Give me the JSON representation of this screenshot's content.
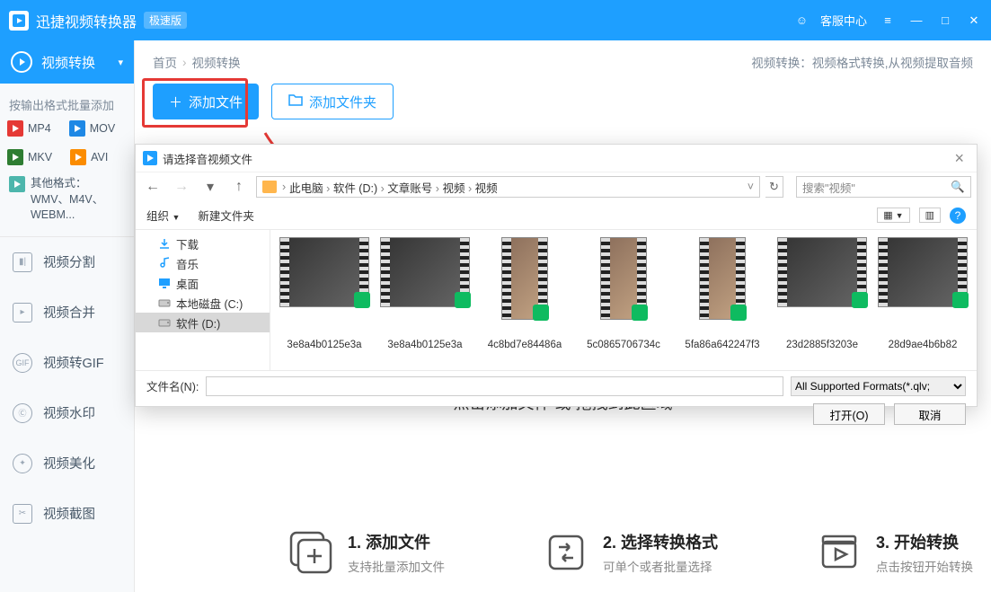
{
  "titlebar": {
    "app_name": "迅捷视频转换器",
    "edition": "极速版",
    "customer_service": "客服中心"
  },
  "sidebar": {
    "active_nav": "视频转换",
    "batch_label": "按输出格式批量添加",
    "formats": [
      {
        "label": "MP4",
        "color": "#E53935"
      },
      {
        "label": "MOV",
        "color": "#1E88E5"
      },
      {
        "label": "MKV",
        "color": "#2E7D32"
      },
      {
        "label": "AVI",
        "color": "#FB8C00"
      }
    ],
    "other_formats": "其他格式：WMV、M4V、WEBM...",
    "nav_items": [
      {
        "label": "视频分割"
      },
      {
        "label": "视频合并"
      },
      {
        "label": "视频转GIF"
      },
      {
        "label": "视频水印"
      },
      {
        "label": "视频美化"
      },
      {
        "label": "视频截图"
      }
    ]
  },
  "breadcrumb": {
    "home": "首页",
    "current": "视频转换",
    "desc": "视频转换：视频格式转换,从视频提取音频"
  },
  "actions": {
    "add_file": "添加文件",
    "add_folder": "添加文件夹"
  },
  "drop_hint": "点击添加文件 或 拖拽到此区域",
  "steps": [
    {
      "title": "1. 添加文件",
      "sub": "支持批量添加文件"
    },
    {
      "title": "2. 选择转换格式",
      "sub": "可单个或者批量选择"
    },
    {
      "title": "3. 开始转换",
      "sub": "点击按钮开始转换"
    }
  ],
  "dialog": {
    "title": "请选择音视频文件",
    "path": [
      "此电脑",
      "软件 (D:)",
      "文章账号",
      "视频",
      "视频"
    ],
    "search_placeholder": "搜索\"视频\"",
    "organize": "组织",
    "new_folder": "新建文件夹",
    "tree": [
      {
        "label": "下载",
        "icon": "download"
      },
      {
        "label": "音乐",
        "icon": "music"
      },
      {
        "label": "桌面",
        "icon": "desktop"
      },
      {
        "label": "本地磁盘 (C:)",
        "icon": "disk"
      },
      {
        "label": "软件 (D:)",
        "icon": "disk",
        "selected": true
      }
    ],
    "files": [
      {
        "name": "3e8a4b0125e3a",
        "shape": "wide",
        "badge": "play"
      },
      {
        "name": "3e8a4b0125e3a",
        "shape": "wide",
        "badge": "play"
      },
      {
        "name": "4c8bd7e84486a",
        "shape": "tall",
        "badge": "iqiyi"
      },
      {
        "name": "5c0865706734c",
        "shape": "tall",
        "badge": "iqiyi"
      },
      {
        "name": "5fa86a642247f3",
        "shape": "tall",
        "badge": "iqiyi"
      },
      {
        "name": "23d2885f3203e",
        "shape": "wide",
        "badge": "iqiyi"
      },
      {
        "name": "28d9ae4b6b82",
        "shape": "wide",
        "badge": "iqiyi"
      }
    ],
    "filename_label": "文件名(N):",
    "filter": "All Supported Formats(*.qlv;",
    "open_btn": "打开(O)",
    "cancel_btn": "取消"
  }
}
